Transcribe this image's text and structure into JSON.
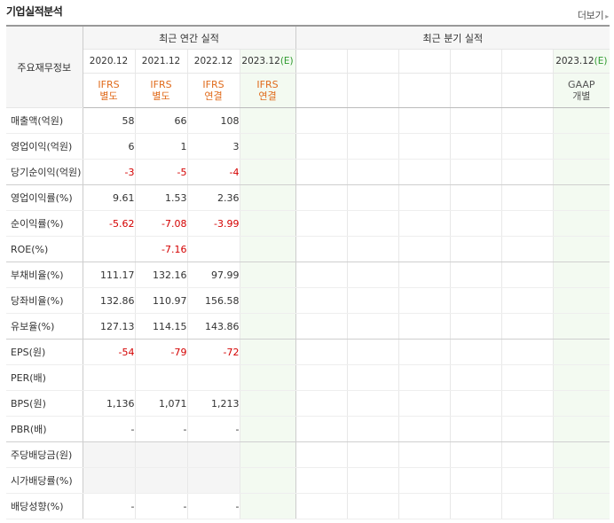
{
  "header": {
    "title": "기업실적분석",
    "more_label": "더보기"
  },
  "table": {
    "label_header": "주요재무정보",
    "annual_group": "최근 연간 실적",
    "quarter_group": "최근 분기 실적",
    "annual_periods": [
      {
        "period": "2020.12",
        "basis": [
          "IFRS",
          "별도"
        ]
      },
      {
        "period": "2021.12",
        "basis": [
          "IFRS",
          "별도"
        ]
      },
      {
        "period": "2022.12",
        "basis": [
          "IFRS",
          "연결"
        ]
      },
      {
        "period": "2023.12",
        "estimate_mark": "(E)",
        "basis": [
          "IFRS",
          "연결"
        ]
      }
    ],
    "quarter_periods": [
      {
        "period": "",
        "basis": [
          "",
          ""
        ]
      },
      {
        "period": "",
        "basis": [
          "",
          ""
        ]
      },
      {
        "period": "",
        "basis": [
          "",
          ""
        ]
      },
      {
        "period": "",
        "basis": [
          "",
          ""
        ]
      },
      {
        "period": "",
        "basis": [
          "",
          ""
        ]
      },
      {
        "period": "2023.12",
        "estimate_mark": "(E)",
        "basis": [
          "GAAP",
          "개별"
        ]
      }
    ],
    "rows": [
      {
        "label": "매출액(억원)",
        "values": [
          "58",
          "66",
          "108",
          ""
        ]
      },
      {
        "label": "영업이익(억원)",
        "values": [
          "6",
          "1",
          "3",
          ""
        ]
      },
      {
        "label": "당기순이익(억원)",
        "values": [
          "-3",
          "-5",
          "-4",
          ""
        ]
      },
      {
        "label": "영업이익률(%)",
        "values": [
          "9.61",
          "1.53",
          "2.36",
          ""
        ]
      },
      {
        "label": "순이익률(%)",
        "values": [
          "-5.62",
          "-7.08",
          "-3.99",
          ""
        ]
      },
      {
        "label": "ROE(%)",
        "values": [
          "",
          "-7.16",
          "",
          ""
        ]
      },
      {
        "label": "부채비율(%)",
        "values": [
          "111.17",
          "132.16",
          "97.99",
          ""
        ]
      },
      {
        "label": "당좌비율(%)",
        "values": [
          "132.86",
          "110.97",
          "156.58",
          ""
        ]
      },
      {
        "label": "유보율(%)",
        "values": [
          "127.13",
          "114.15",
          "143.86",
          ""
        ]
      },
      {
        "label": "EPS(원)",
        "values": [
          "-54",
          "-79",
          "-72",
          ""
        ]
      },
      {
        "label": "PER(배)",
        "values": [
          "",
          "",
          "",
          ""
        ]
      },
      {
        "label": "BPS(원)",
        "values": [
          "1,136",
          "1,071",
          "1,213",
          ""
        ]
      },
      {
        "label": "PBR(배)",
        "values": [
          "-",
          "-",
          "-",
          ""
        ]
      },
      {
        "label": "주당배당금(원)",
        "values": [
          "",
          "",
          "",
          ""
        ]
      },
      {
        "label": "시가배당률(%)",
        "values": [
          "",
          "",
          "",
          ""
        ]
      },
      {
        "label": "배당성향(%)",
        "values": [
          "-",
          "-",
          "-",
          ""
        ]
      }
    ]
  },
  "colors": {
    "negative": "#d40000",
    "basis_ifrs": "#e06b1c",
    "estimate_mark": "#2e9a2e",
    "estimate_bg": "#f3faf1"
  }
}
